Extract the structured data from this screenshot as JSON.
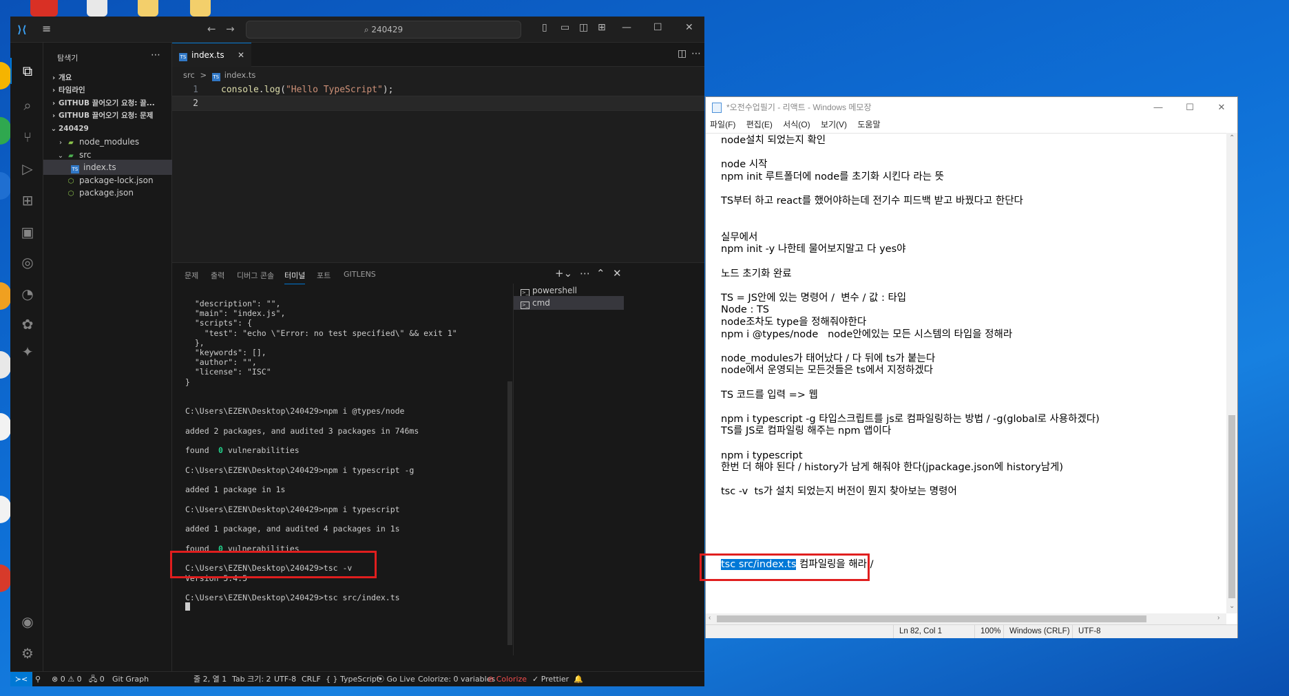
{
  "vscode": {
    "search_text": "240429",
    "explorer_title": "탐색기",
    "tree": [
      {
        "label": "개요",
        "kind": "section"
      },
      {
        "label": "타임라인",
        "kind": "section"
      },
      {
        "label": "GITHUB 끌어오기 요청: 끌...",
        "kind": "section"
      },
      {
        "label": "GITHUB 끌어오기 요청: 문제",
        "kind": "section"
      },
      {
        "label": "240429",
        "kind": "section"
      },
      {
        "label": "node_modules",
        "kind": "folder"
      },
      {
        "label": "src",
        "kind": "folder"
      },
      {
        "label": "index.ts",
        "kind": "file"
      },
      {
        "label": "package-lock.json",
        "kind": "file"
      },
      {
        "label": "package.json",
        "kind": "file"
      }
    ],
    "tab_label": "index.ts",
    "breadcrumb": {
      "folder": "src",
      "sep": ">",
      "file": "index.ts"
    },
    "code": {
      "line1_num": "1",
      "line2_num": "2",
      "line1": {
        "obj": "console",
        "dot": ".",
        "fn": "log",
        "open": "(",
        "str": "\"Hello TypeScript\"",
        "close": ");"
      }
    },
    "panel_tabs": [
      "문제",
      "출력",
      "디버그 콘솔",
      "터미널",
      "포트",
      "GITLENS"
    ],
    "terminal_lines": [
      "  \"description\": \"\",",
      "  \"main\": \"index.js\",",
      "  \"scripts\": {",
      "    \"test\": \"echo \\\"Error: no test specified\\\" && exit 1\"",
      "  },",
      "  \"keywords\": [],",
      "  \"author\": \"\",",
      "  \"license\": \"ISC\"",
      "}",
      "",
      "",
      "C:\\Users\\EZEN\\Desktop\\240429>npm i @types/node",
      "",
      "added 2 packages, and audited 3 packages in 746ms",
      "",
      "found ",
      "",
      "C:\\Users\\EZEN\\Desktop\\240429>npm i typescript -g",
      "",
      "added 1 package in 1s",
      "",
      "C:\\Users\\EZEN\\Desktop\\240429>npm i typescript",
      "",
      "added 1 package, and audited 4 packages in 1s",
      "",
      "found ",
      "",
      "C:\\Users\\EZEN\\Desktop\\240429>tsc -v",
      "Version 5.4.5",
      "",
      "C:\\Users\\EZEN\\Desktop\\240429>tsc src/index.ts"
    ],
    "terminal_found_zero": "0",
    "terminal_found_rest": " vulnerabilities",
    "terminal_list": [
      "powershell",
      "cmd"
    ],
    "status": {
      "errors": "⊗ 0 ⚠ 0",
      "ports": "🖧 0",
      "git_graph": "Git Graph",
      "position": "줄 2, 열 1",
      "tab_size": "Tab 크기: 2",
      "encoding": "UTF-8",
      "eol": "CRLF",
      "language": "{ } TypeScript",
      "go_live": "Go Live",
      "colorize_vars": "Colorize: 0 variables",
      "colorize": "Colorize",
      "prettier": "✓ Prettier"
    }
  },
  "notepad": {
    "title": "*오전수업필기 - 리액트 - Windows 메모장",
    "menu": [
      "파일(F)",
      "편집(E)",
      "서식(O)",
      "보기(V)",
      "도움말"
    ],
    "lines": [
      "node설치 되었는지 확인",
      "",
      "node 시작",
      "npm init 루트폴더에 node를 초기화 시킨다 라는 뜻",
      "",
      "TS부터 하고 react를 했어야하는데 전기수 피드백 받고 바꿨다고 한단다",
      "",
      "",
      "실무에서",
      "npm init -y 나한테 물어보지말고 다 yes야",
      "",
      "노드 초기화 완료",
      "",
      "TS = JS안에 있는 명령어 /  변수 / 값 : 타입",
      "Node : TS",
      "node조차도 type을 정해줘야한다",
      "npm i @types/node   node안에있는 모든 시스템의 타입을 정해라",
      "",
      "node_modules가 태어났다 / 다 뒤에 ts가 붙는다",
      "node에서 운영되는 모든것들은 ts에서 지정하겠다",
      "",
      "TS 코드를 입력 => 웹",
      "",
      "npm i typescript -g 타입스크립트를 js로 컴파일링하는 방법 / -g(global로 사용하겠다)",
      "TS를 JS로 컴파일링 해주는 npm 앱이다",
      "",
      "npm i typescript",
      "한번 더 해야 된다 / history가 남게 해줘야 한다(jpackage.json에 history남게)",
      "",
      "tsc -v  ts가 설치 되었는지 버전이 뭔지 찾아보는 명령어",
      ""
    ],
    "last_line_selected": "tsc src/index.ts",
    "last_line_rest": " 컴파일링을 해라 /",
    "status": {
      "position": "Ln 82, Col 1",
      "zoom": "100%",
      "eol": "Windows (CRLF)",
      "encoding": "UTF-8"
    }
  }
}
